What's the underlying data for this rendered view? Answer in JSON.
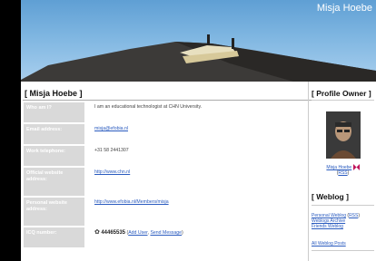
{
  "banner": {
    "site_title": "Misja Hoebe"
  },
  "profile": {
    "heading": "[ Misja Hoebe ]",
    "rows": [
      {
        "label": "Who am I?",
        "value": "I am an educational technologist at CHN University."
      },
      {
        "label": "Email address:",
        "value": "misja@efobia.nl"
      },
      {
        "label": "Work telephone:",
        "value": "+31 58 2441307"
      },
      {
        "label_line1": "Official website",
        "label_line2": "address:",
        "value": "http://www.chn.nl"
      },
      {
        "label_line1": "Personal website",
        "label_line2": "address:",
        "value": "http://www.efobia.nl/Members/misja"
      },
      {
        "label": "ICQ number:",
        "value": "44465535",
        "add_user": "Add User",
        "send_message": "Send Message"
      }
    ]
  },
  "sidebar": {
    "owner_heading": "[ Profile Owner ]",
    "owner_name": "Misja Hoebe",
    "owner_rss": "RSS",
    "weblog_heading": "[ Weblog ]",
    "personal_weblog": "Personal Weblog",
    "personal_weblog_rss": "RSS",
    "weblogs_archive": "Weblogs Archive",
    "friends_weblog": "Friends Weblog",
    "all_weblog_posts": "All Weblog Posts"
  }
}
